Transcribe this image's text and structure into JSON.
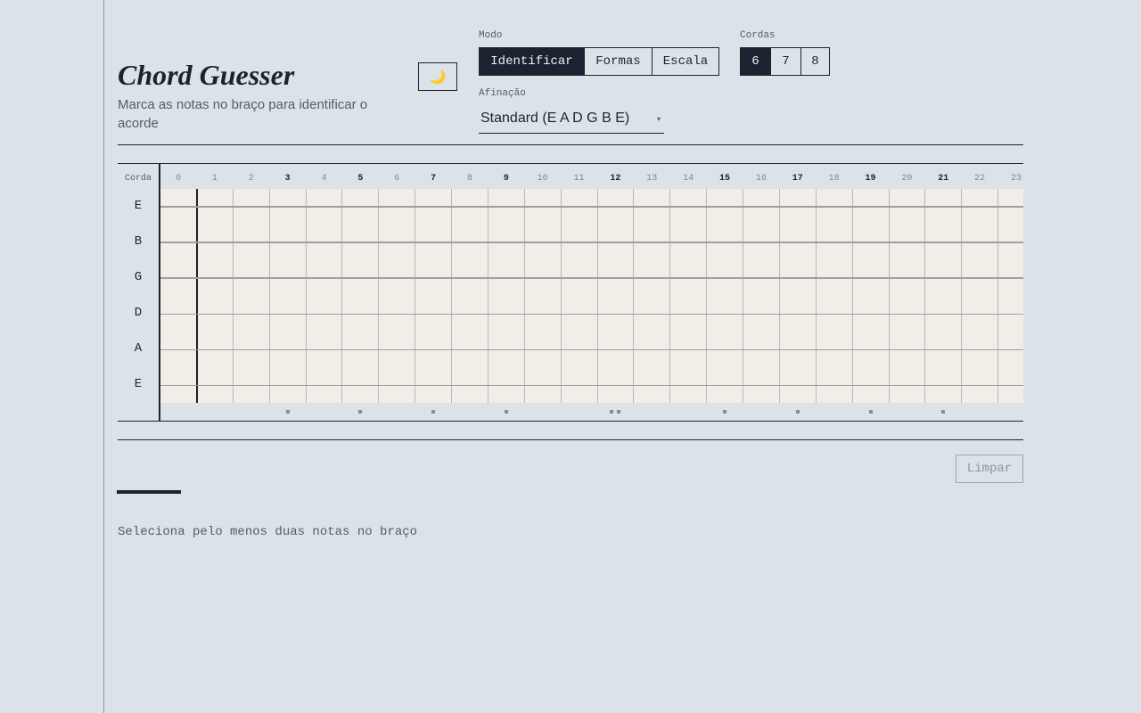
{
  "app": {
    "title": "Chord Guesser",
    "subtitle": "Marca as notas no braço para identificar o acorde",
    "theme_icon": "🌙"
  },
  "mode": {
    "label": "Modo",
    "options": [
      "Identificar",
      "Formas",
      "Escala"
    ],
    "selected": "Identificar"
  },
  "strings_count": {
    "label": "Cordas",
    "options": [
      "6",
      "7",
      "8"
    ],
    "selected": "6"
  },
  "tuning": {
    "label": "Afinação",
    "value": "Standard (E A D G B E)",
    "caret": "▾"
  },
  "fretboard": {
    "string_header": "Corda",
    "frets": [
      "0",
      "1",
      "2",
      "3",
      "4",
      "5",
      "6",
      "7",
      "8",
      "9",
      "10",
      "11",
      "12",
      "13",
      "14",
      "15",
      "16",
      "17",
      "18",
      "19",
      "20",
      "21",
      "22",
      "23"
    ],
    "marked_frets": [
      "3",
      "5",
      "7",
      "9",
      "12",
      "15",
      "17",
      "19",
      "21"
    ],
    "strings": [
      "E",
      "B",
      "G",
      "D",
      "A",
      "E"
    ],
    "inlays": [
      "3",
      "5",
      "7",
      "9",
      "12",
      "15",
      "17",
      "19",
      "21"
    ],
    "double_inlays": [
      "12"
    ]
  },
  "actions": {
    "clear_label": "Limpar"
  },
  "result": {
    "hint": "Seleciona pelo menos duas notas no braço"
  },
  "colors": {
    "background": "#dce3e8",
    "ink": "#1b2330",
    "fretboard": "#f2ede6",
    "muted": "#4f5d6c"
  }
}
